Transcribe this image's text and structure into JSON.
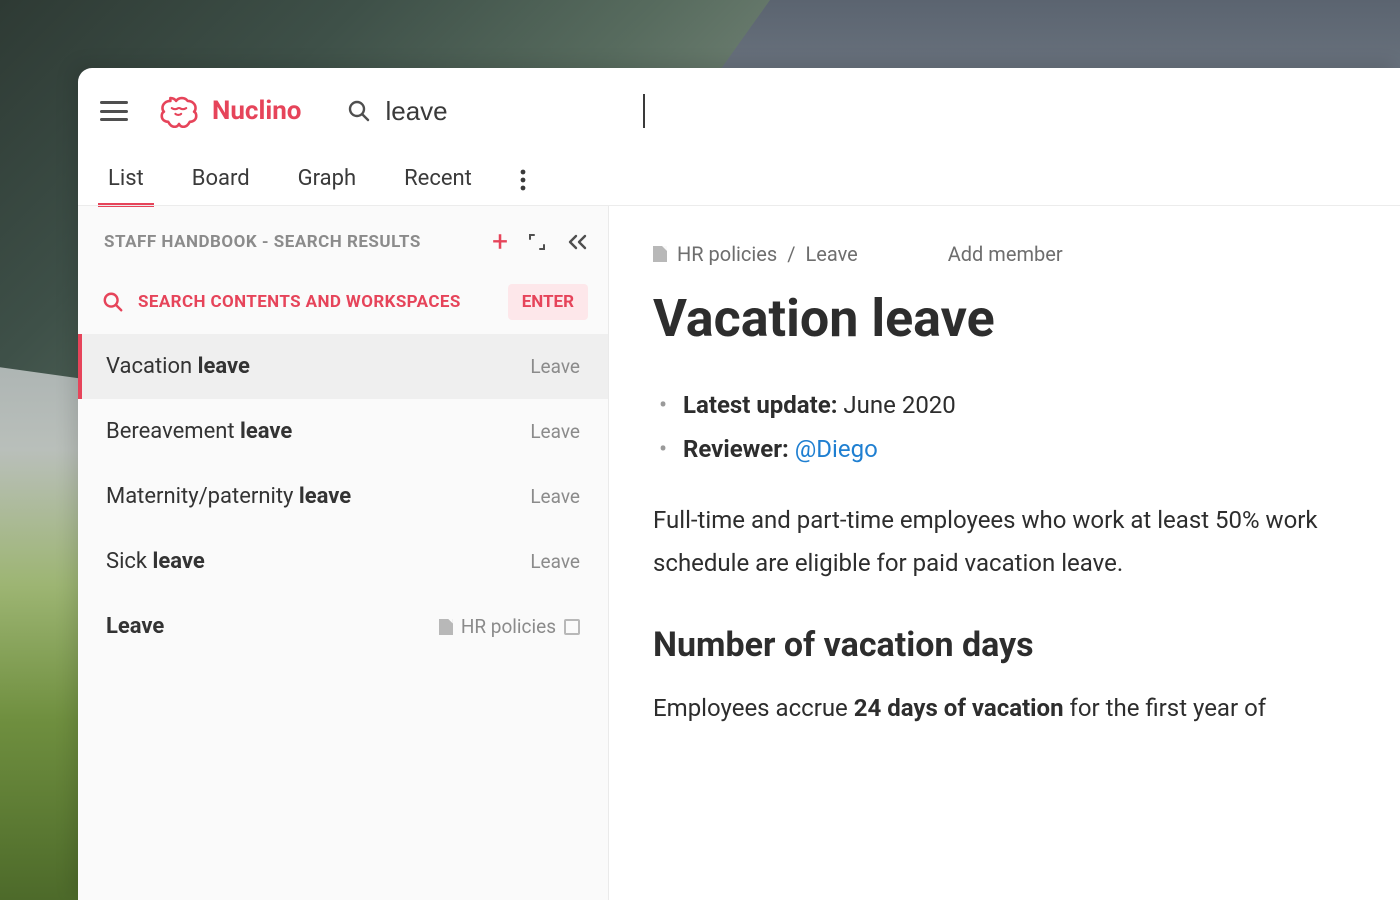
{
  "brand": {
    "name": "Nuclino"
  },
  "search": {
    "value": "leave"
  },
  "tabs": {
    "items": [
      "List",
      "Board",
      "Graph",
      "Recent"
    ],
    "active_index": 0
  },
  "sidebar": {
    "header_title": "STAFF HANDBOOK - SEARCH RESULTS",
    "search_all_label": "SEARCH CONTENTS AND WORKSPACES",
    "enter_label": "ENTER",
    "results": [
      {
        "prefix": "Vacation ",
        "match": "leave",
        "suffix": "",
        "category": "Leave",
        "selected": true,
        "show_doc_icon": false,
        "show_copy_icon": false
      },
      {
        "prefix": "Bereavement ",
        "match": "leave",
        "suffix": "",
        "category": "Leave",
        "selected": false,
        "show_doc_icon": false,
        "show_copy_icon": false
      },
      {
        "prefix": "Maternity/paternity ",
        "match": "leave",
        "suffix": "",
        "category": "Leave",
        "selected": false,
        "show_doc_icon": false,
        "show_copy_icon": false
      },
      {
        "prefix": "Sick ",
        "match": "leave",
        "suffix": "",
        "category": "Leave",
        "selected": false,
        "show_doc_icon": false,
        "show_copy_icon": false
      },
      {
        "prefix": "",
        "match": "Leave",
        "suffix": "",
        "category": "HR policies",
        "selected": false,
        "show_doc_icon": true,
        "show_copy_icon": true
      }
    ]
  },
  "content": {
    "breadcrumb": {
      "segment1": "HR policies",
      "sep": " / ",
      "segment2": "Leave"
    },
    "add_member_label": "Add member",
    "title": "Vacation leave",
    "meta": {
      "update_label": "Latest update:",
      "update_value": " June 2020",
      "reviewer_label": "Reviewer:",
      "reviewer_mention": "@Diego"
    },
    "intro_para": "Full-time and part-time employees who work at least 50% work schedule are eligible for paid vacation leave.",
    "section_heading": "Number of vacation days",
    "section_para_prefix": "Employees accrue ",
    "section_para_bold": "24 days of vacation",
    "section_para_suffix": " for the first year of"
  }
}
